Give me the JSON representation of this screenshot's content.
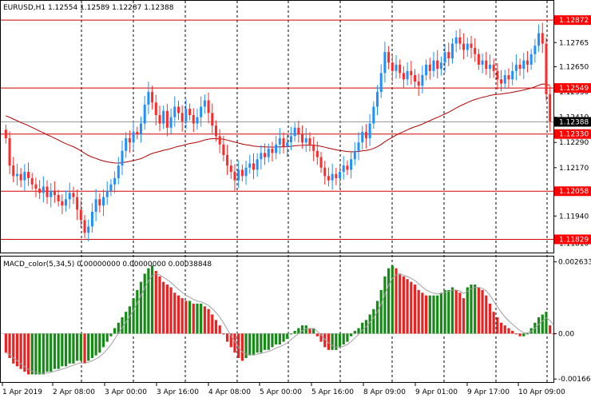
{
  "window": {
    "symbol_header": "EURUSD,H1  1.12554 1.12589 1.12287 1.12388",
    "indicator_header": "MACD_color(5,34,5) 0.00000000 0.00000000 0.00038848"
  },
  "colors": {
    "bull_candle": "#1e90ff",
    "bear_candle": "#ff2a2a",
    "level_line": "#d00000",
    "moving_average": "#b00000",
    "macd_up": "#168a16",
    "macd_down": "#ee2020",
    "signal_line": "#a0a0a0",
    "current_price_bg": "#000000",
    "level_label_bg": "#ff0000"
  },
  "price_axis": {
    "min": 1.1177,
    "max": 1.1296,
    "ticks": [
      "1.12765",
      "1.12650",
      "1.12530",
      "1.12410",
      "1.12290",
      "1.12170",
      "1.11940",
      "1.11810"
    ],
    "level_labels": [
      "1.12872",
      "1.12549",
      "1.12330",
      "1.12058",
      "1.11829"
    ],
    "current_price_label": "1.12388"
  },
  "macd_axis": {
    "min": -0.00175,
    "max": 0.0028,
    "ticks": [
      "0.0026330",
      "0.00",
      "-0.001669"
    ]
  },
  "time_axis": {
    "labels": [
      "1 Apr 2019",
      "2 Apr 08:00",
      "3 Apr 00:00",
      "3 Apr 16:00",
      "4 Apr 08:00",
      "5 Apr 00:00",
      "5 Apr 16:00",
      "8 Apr 09:00",
      "9 Apr 01:00",
      "9 Apr 17:00",
      "10 Apr 09:00"
    ]
  },
  "chart_data": {
    "type": "candlestick",
    "symbol": "EURUSD",
    "timeframe": "H1",
    "horizontal_levels": [
      1.12872,
      1.12549,
      1.1233,
      1.12058,
      1.11829
    ],
    "current_price": 1.12388,
    "closes": [
      1.1231,
      1.1218,
      1.1213,
      1.1214,
      1.1211,
      1.1215,
      1.1212,
      1.1209,
      1.1207,
      1.1205,
      1.1208,
      1.1203,
      1.1206,
      1.1204,
      1.1201,
      1.1199,
      1.1202,
      1.1205,
      1.1203,
      1.1197,
      1.1192,
      1.1186,
      1.1189,
      1.1196,
      1.1202,
      1.1199,
      1.1203,
      1.1206,
      1.1209,
      1.1212,
      1.1218,
      1.1225,
      1.1231,
      1.1229,
      1.1234,
      1.1233,
      1.1238,
      1.1247,
      1.1253,
      1.1248,
      1.1242,
      1.1238,
      1.1244,
      1.1236,
      1.1241,
      1.1246,
      1.1243,
      1.1239,
      1.1245,
      1.1242,
      1.1238,
      1.1241,
      1.1246,
      1.1249,
      1.1243,
      1.1237,
      1.1232,
      1.1228,
      1.1223,
      1.1218,
      1.1215,
      1.1211,
      1.1216,
      1.1213,
      1.1217,
      1.1219,
      1.1216,
      1.1221,
      1.1224,
      1.1222,
      1.1226,
      1.1224,
      1.1228,
      1.1231,
      1.1227,
      1.1229,
      1.1232,
      1.1236,
      1.1233,
      1.1229,
      1.1231,
      1.1228,
      1.1225,
      1.1222,
      1.1217,
      1.1213,
      1.1211,
      1.1214,
      1.1212,
      1.1215,
      1.1218,
      1.1216,
      1.1221,
      1.1225,
      1.1229,
      1.1234,
      1.1231,
      1.1238,
      1.1246,
      1.1253,
      1.1262,
      1.1272,
      1.1267,
      1.1263,
      1.1266,
      1.1262,
      1.1259,
      1.1263,
      1.1261,
      1.1258,
      1.1256,
      1.1261,
      1.1266,
      1.1263,
      1.1268,
      1.1264,
      1.1267,
      1.1272,
      1.1269,
      1.1276,
      1.1279,
      1.1276,
      1.1273,
      1.1276,
      1.1274,
      1.1271,
      1.1266,
      1.1268,
      1.1264,
      1.1266,
      1.1263,
      1.1259,
      1.1257,
      1.1261,
      1.1259,
      1.1263,
      1.1266,
      1.1264,
      1.1268,
      1.1266,
      1.1271,
      1.1275,
      1.1281,
      1.1276,
      1.1252,
      1.1239
    ],
    "macd": [
      -0.0007,
      -0.0009,
      -0.0011,
      -0.0012,
      -0.0013,
      -0.0014,
      -0.0015,
      -0.0015,
      -0.0015,
      -0.0015,
      -0.0015,
      -0.0014,
      -0.0014,
      -0.0013,
      -0.0013,
      -0.0012,
      -0.0012,
      -0.0011,
      -0.0011,
      -0.001,
      -0.001,
      -0.0011,
      -0.001,
      -0.0009,
      -0.0008,
      -0.0007,
      -0.0005,
      -0.0003,
      -0.0001,
      0.0002,
      0.0004,
      0.0006,
      0.0008,
      0.001,
      0.0013,
      0.0016,
      0.0019,
      0.0022,
      0.0024,
      0.0025,
      0.0023,
      0.0021,
      0.0019,
      0.0018,
      0.0017,
      0.0015,
      0.0014,
      0.0013,
      0.0012,
      0.0012,
      0.0011,
      0.0011,
      0.0011,
      0.001,
      0.0009,
      0.0007,
      0.0005,
      0.0003,
      0.0,
      -0.0003,
      -0.0005,
      -0.0007,
      -0.0009,
      -0.001,
      -0.0009,
      -0.0008,
      -0.0008,
      -0.0007,
      -0.0007,
      -0.0006,
      -0.0006,
      -0.0005,
      -0.0004,
      -0.0004,
      -0.0003,
      -0.0002,
      0.0,
      0.0001,
      0.0002,
      0.0003,
      0.0003,
      0.0002,
      0.0002,
      -0.0001,
      -0.0003,
      -0.0005,
      -0.0006,
      -0.0006,
      -0.0006,
      -0.0005,
      -0.0004,
      -0.0003,
      -0.0001,
      0.0001,
      0.0002,
      0.0004,
      0.0005,
      0.0007,
      0.0009,
      0.0012,
      0.0016,
      0.0021,
      0.0024,
      0.0025,
      0.0024,
      0.0022,
      0.0021,
      0.002,
      0.0019,
      0.0018,
      0.0016,
      0.0015,
      0.0014,
      0.0014,
      0.0014,
      0.0014,
      0.0015,
      0.0016,
      0.0016,
      0.0017,
      0.0016,
      0.0015,
      0.0013,
      0.0017,
      0.0018,
      0.0018,
      0.0017,
      0.0016,
      0.0014,
      0.0011,
      0.0008,
      0.0006,
      0.0004,
      0.0003,
      0.0002,
      0.0001,
      0.0,
      -0.0001,
      -0.0001,
      0.0,
      0.0002,
      0.0004,
      0.0006,
      0.0007,
      0.0008,
      0.0003,
      0.0
    ]
  }
}
